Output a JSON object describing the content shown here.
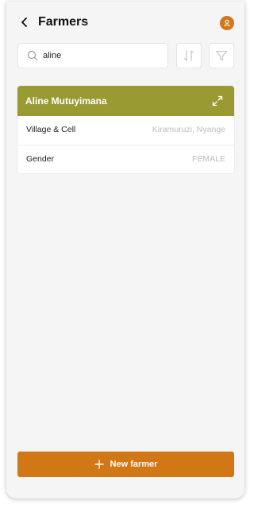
{
  "header": {
    "title": "Farmers",
    "back_icon": "chevron-left-icon",
    "profile_icon": "user-icon"
  },
  "search": {
    "value": "aline",
    "icon": "search-icon"
  },
  "toolbar": {
    "sort_icon": "sort-icon",
    "filter_icon": "filter-icon"
  },
  "farmer_card": {
    "name": "Aline Mutuyimana",
    "expand_icon": "expand-icon",
    "rows": [
      {
        "label": "Village & Cell",
        "value": "Kiramuruzi, Nyange"
      },
      {
        "label": "Gender",
        "value": "FEMALE"
      }
    ]
  },
  "new_button": {
    "label": "New farmer",
    "icon": "plus-icon"
  },
  "colors": {
    "card_header": "#9a9a33",
    "accent": "#d27716",
    "avatar": "#d4761a"
  }
}
